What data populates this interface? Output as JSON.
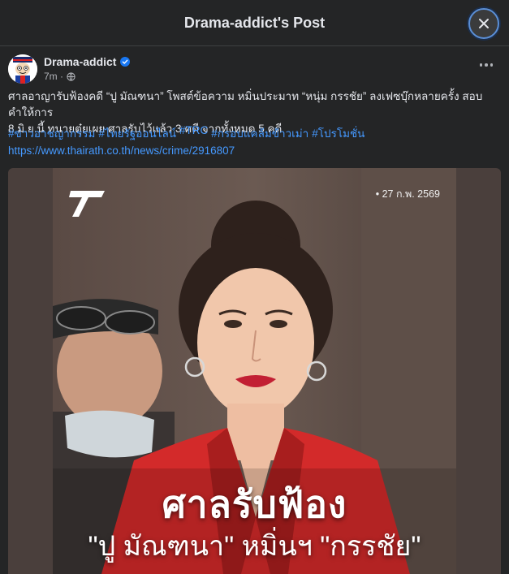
{
  "header": {
    "title": "Drama-addict's Post"
  },
  "post": {
    "author": "Drama-addict",
    "time": "7m ·",
    "body_line1": "ศาลอาญารับฟ้องคดี “ปู มัณฑนา” โพสต์ข้อความ หมิ่นประมาท “หนุ่ม กรรชัย” ลงเฟซบุ๊กหลายครั้ง สอบคำให้การ",
    "body_line2": "8 มิ.ย.นี้ ทนายตุ๋ยเผย ศาลรับไว้แล้ว 3 คดี จากทั้งหมด 5 คดี",
    "hashtags": [
      "#ข่าวอาชญากรรม",
      "#ไทยรัฐออนไลน์",
      "#TRC",
      "#กรอบแคล้มข้าวเม่า",
      "#โปรโมชั่น"
    ],
    "link": "https://www.thairath.co.th/news/crime/2916807"
  },
  "media": {
    "date": "• 27 ก.พ. 2569",
    "headline1": "ศาลรับฟ้อง",
    "headline2": "\"ปู มัณฑนา\" หมิ่นฯ \"กรรชัย\""
  },
  "colors": {
    "background": "#242526",
    "link": "#4599ff",
    "jacket": "#d32a2a"
  },
  "icons": [
    "close-icon",
    "verified-badge-icon",
    "globe-icon",
    "more-options-icon"
  ]
}
